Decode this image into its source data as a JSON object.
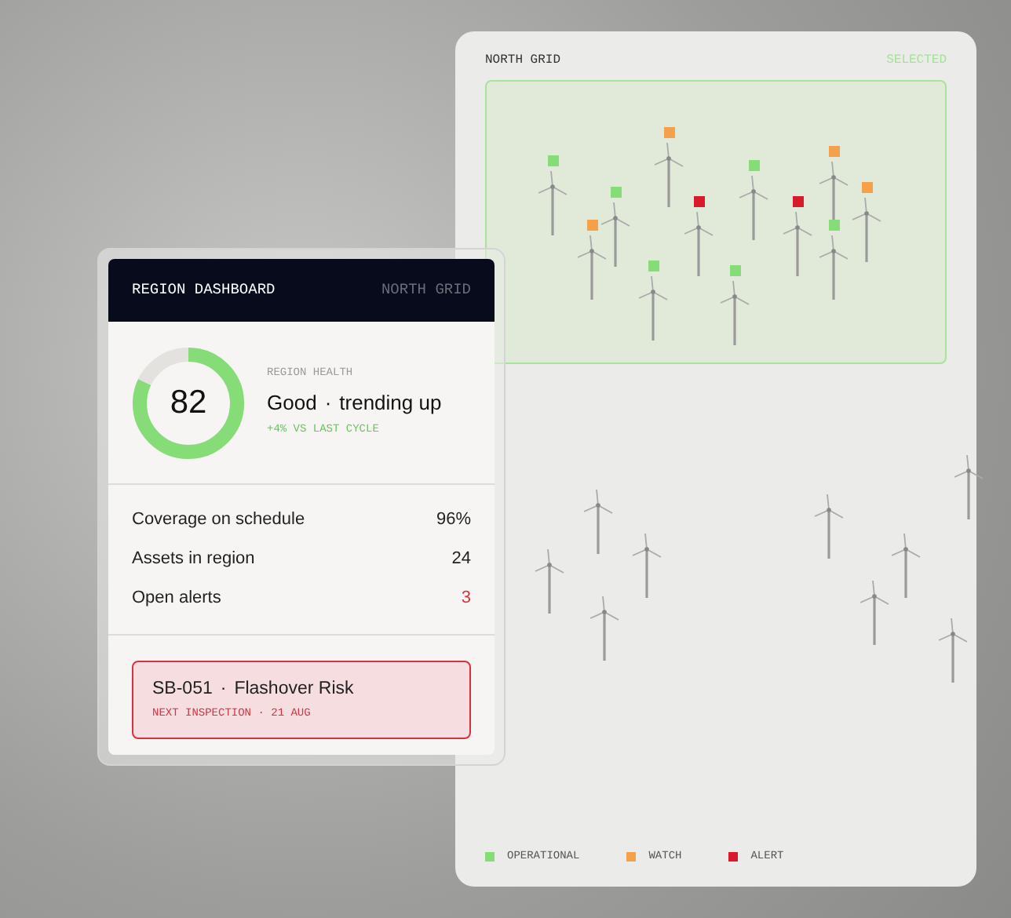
{
  "map_panel": {
    "title": "NORTH GRID",
    "zone_badge": "SELECTED",
    "zone_selected": true,
    "turbines": [
      {
        "color": "#86dd78"
      },
      {
        "color": "#f5a04a"
      },
      {
        "color": "#86dd78"
      },
      {
        "color": "#f5a04a"
      },
      {
        "color": "#d81b2c"
      },
      {
        "color": "#86dd78"
      },
      {
        "color": "#86dd78"
      },
      {
        "color": "#86dd78"
      },
      {
        "color": "#d81b2c"
      },
      {
        "color": "#f5a04a"
      },
      {
        "color": "#f5a04a"
      },
      {
        "color": "#86dd78"
      }
    ],
    "legend": [
      {
        "label": "OPERATIONAL",
        "color": "#86dd78"
      },
      {
        "label": "WATCH",
        "color": "#f5a04a"
      },
      {
        "label": "ALERT",
        "color": "#d81b2c"
      }
    ]
  },
  "dashboard": {
    "title": "REGION DASHBOARD",
    "region": "NORTH GRID",
    "health": {
      "score": "82",
      "level": 0.82,
      "label": "REGION HEALTH",
      "status": "Good",
      "separator": "·",
      "trend": "trending up",
      "delta": "+4% VS LAST CYCLE"
    },
    "stats": [
      {
        "label": "Coverage on schedule",
        "value": "96%",
        "alert": false
      },
      {
        "label": "Assets in region",
        "value": "24",
        "alert": false
      },
      {
        "label": "Open alerts",
        "value": "3",
        "alert": true
      }
    ],
    "alert": {
      "asset": "SB-051",
      "separator": "·",
      "issue": "Flashover Risk",
      "detail": "NEXT INSPECTION · 21 AUG"
    }
  }
}
